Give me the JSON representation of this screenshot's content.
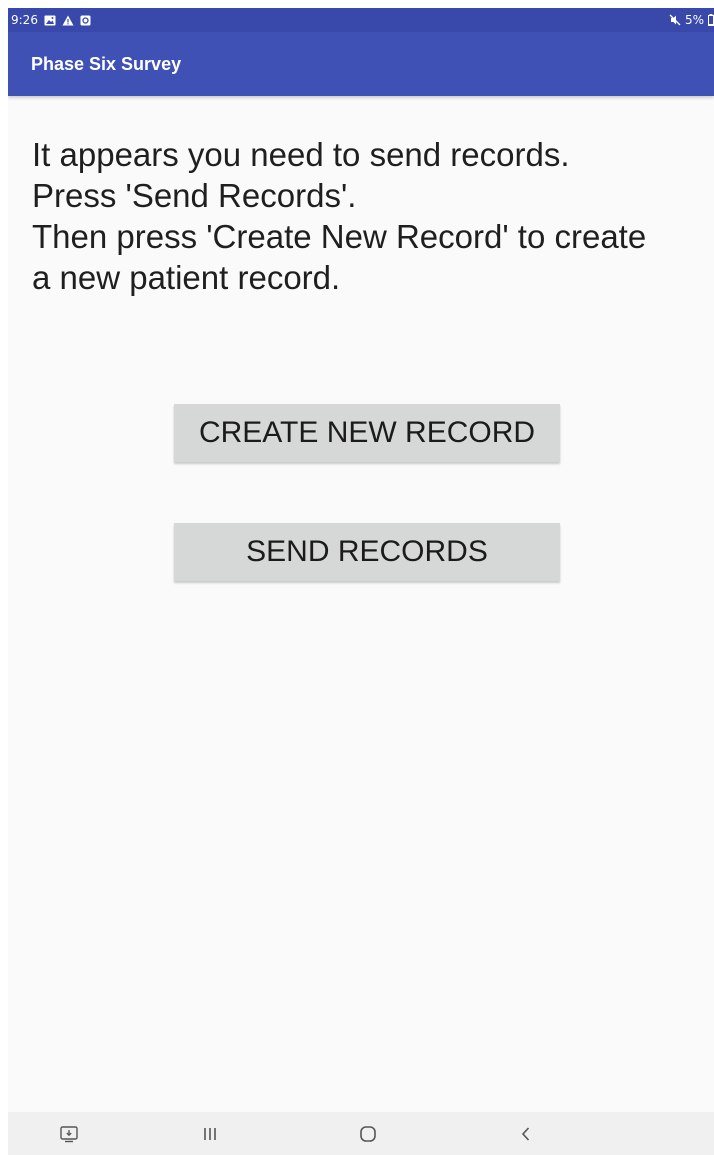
{
  "status_bar": {
    "time": "9:26",
    "battery": "5%",
    "icons": [
      "gallery-icon",
      "warning-icon",
      "sync-icon",
      "mute-icon",
      "battery-icon"
    ]
  },
  "app_bar": {
    "title": "Phase Six Survey"
  },
  "main": {
    "message_lines": [
      "It appears you need to send records.",
      "Press 'Send Records'.",
      "Then press 'Create New Record' to create",
      "a new patient record."
    ],
    "create_button_label": "CREATE NEW RECORD",
    "send_button_label": "SEND RECORDS"
  },
  "nav_bar": {
    "icons": [
      "screen-cast-icon",
      "recent-apps-icon",
      "home-icon",
      "back-icon"
    ]
  },
  "colors": {
    "app_bar": "#3f51b5",
    "status_bar": "#3849ab",
    "button_bg": "#d6d7d7",
    "background": "#fafafa"
  }
}
